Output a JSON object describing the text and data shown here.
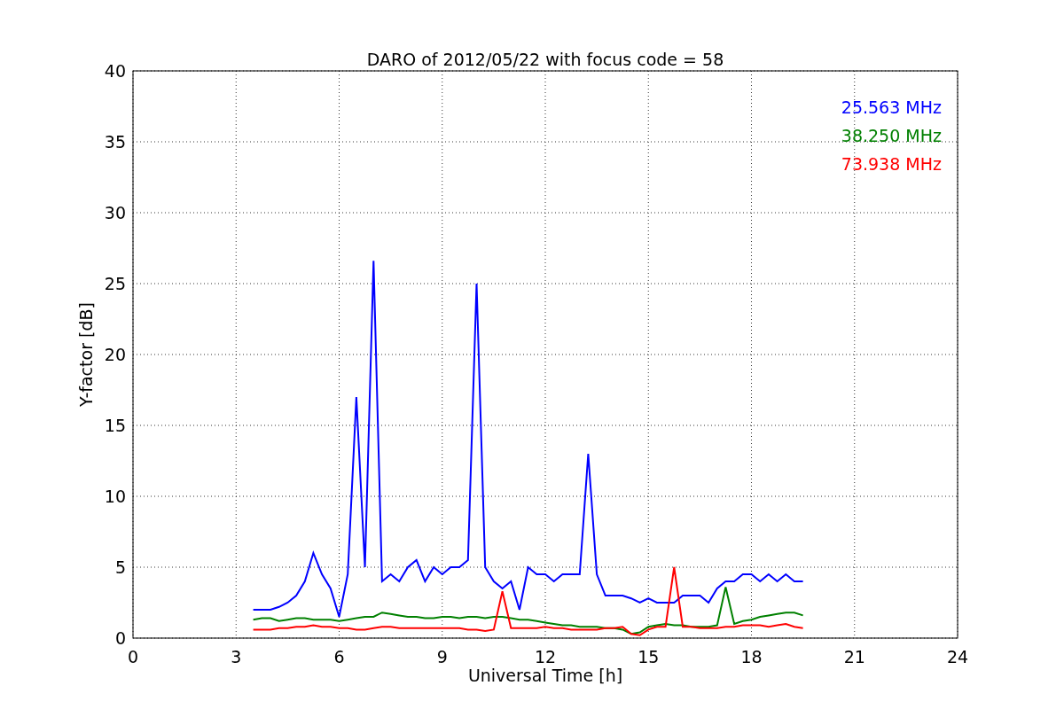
{
  "chart_data": {
    "type": "line",
    "title": "DARO of 2012/05/22 with focus code = 58",
    "xlabel": "Universal Time [h]",
    "ylabel": "Y-factor [dB]",
    "x": [
      3.5,
      3.75,
      4.0,
      4.25,
      4.5,
      4.75,
      5.0,
      5.25,
      5.5,
      5.75,
      6.0,
      6.25,
      6.5,
      6.75,
      7.0,
      7.25,
      7.5,
      7.75,
      8.0,
      8.25,
      8.5,
      8.75,
      9.0,
      9.25,
      9.5,
      9.75,
      10.0,
      10.25,
      10.5,
      10.75,
      11.0,
      11.25,
      11.5,
      11.75,
      12.0,
      12.25,
      12.5,
      12.75,
      13.0,
      13.25,
      13.5,
      13.75,
      14.0,
      14.25,
      14.5,
      14.75,
      15.0,
      15.25,
      15.5,
      15.75,
      16.0,
      16.25,
      16.5,
      16.75,
      17.0,
      17.25,
      17.5,
      17.75,
      18.0,
      18.25,
      18.5,
      18.75,
      19.0,
      19.25,
      19.5
    ],
    "series": [
      {
        "name": "25.563 MHz",
        "color": "#0000ff",
        "values": [
          2.0,
          2.0,
          2.0,
          2.2,
          2.5,
          3.0,
          4.0,
          6.0,
          4.5,
          3.5,
          1.5,
          4.5,
          17.0,
          5.0,
          26.6,
          4.0,
          4.5,
          4.0,
          5.0,
          5.5,
          4.0,
          5.0,
          4.5,
          5.0,
          5.0,
          5.5,
          25.0,
          5.0,
          4.0,
          3.5,
          4.0,
          2.0,
          5.0,
          4.5,
          4.5,
          4.0,
          4.5,
          4.5,
          4.5,
          13.0,
          4.5,
          3.0,
          3.0,
          3.0,
          2.8,
          2.5,
          2.8,
          2.5,
          2.5,
          2.5,
          3.0,
          3.0,
          3.0,
          2.5,
          3.5,
          4.0,
          4.0,
          4.5,
          4.5,
          4.0,
          4.5,
          4.0,
          4.5,
          4.0,
          4.0
        ]
      },
      {
        "name": "38.250 MHz",
        "color": "#008000",
        "values": [
          1.3,
          1.4,
          1.4,
          1.2,
          1.3,
          1.4,
          1.4,
          1.3,
          1.3,
          1.3,
          1.2,
          1.3,
          1.4,
          1.5,
          1.5,
          1.8,
          1.7,
          1.6,
          1.5,
          1.5,
          1.4,
          1.4,
          1.5,
          1.5,
          1.4,
          1.5,
          1.5,
          1.4,
          1.5,
          1.5,
          1.4,
          1.3,
          1.3,
          1.2,
          1.1,
          1.0,
          0.9,
          0.9,
          0.8,
          0.8,
          0.8,
          0.7,
          0.7,
          0.6,
          0.3,
          0.4,
          0.8,
          0.9,
          1.0,
          0.9,
          0.9,
          0.8,
          0.8,
          0.8,
          0.9,
          3.6,
          1.0,
          1.2,
          1.3,
          1.5,
          1.6,
          1.7,
          1.8,
          1.8,
          1.6
        ]
      },
      {
        "name": "73.938 MHz",
        "color": "#ff0000",
        "values": [
          0.6,
          0.6,
          0.6,
          0.7,
          0.7,
          0.8,
          0.8,
          0.9,
          0.8,
          0.8,
          0.7,
          0.7,
          0.6,
          0.6,
          0.7,
          0.8,
          0.8,
          0.7,
          0.7,
          0.7,
          0.7,
          0.7,
          0.7,
          0.7,
          0.7,
          0.6,
          0.6,
          0.5,
          0.6,
          3.3,
          0.7,
          0.7,
          0.7,
          0.7,
          0.8,
          0.7,
          0.7,
          0.6,
          0.6,
          0.6,
          0.6,
          0.7,
          0.7,
          0.8,
          0.3,
          0.2,
          0.6,
          0.8,
          0.8,
          5.0,
          0.8,
          0.8,
          0.7,
          0.7,
          0.7,
          0.8,
          0.8,
          0.9,
          0.9,
          0.9,
          0.8,
          0.9,
          1.0,
          0.8,
          0.7
        ]
      }
    ],
    "xlim": [
      0,
      24
    ],
    "ylim": [
      0,
      40
    ],
    "xticks": [
      0,
      3,
      6,
      9,
      12,
      15,
      18,
      21,
      24
    ],
    "yticks": [
      0,
      5,
      10,
      15,
      20,
      25,
      30,
      35,
      40
    ],
    "grid": true
  }
}
